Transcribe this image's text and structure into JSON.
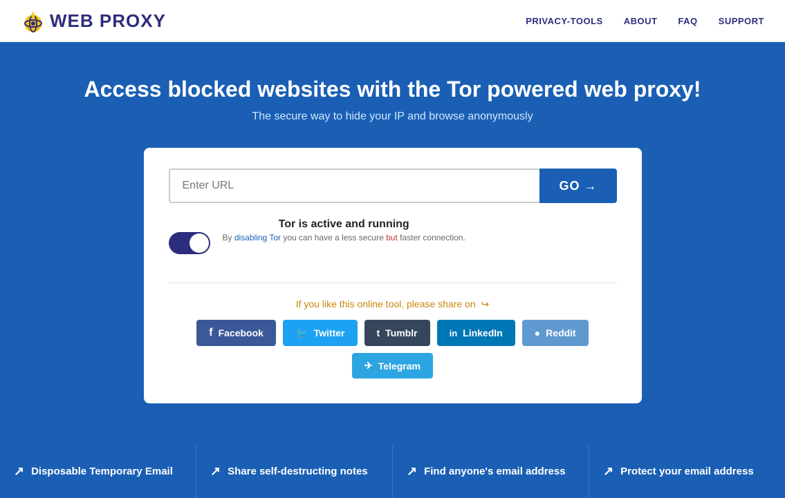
{
  "header": {
    "logo_text_web": "WEB",
    "logo_text_proxy": "PROXY",
    "nav": [
      {
        "label": "PRIVACY-TOOLS",
        "id": "privacy-tools"
      },
      {
        "label": "ABOUT",
        "id": "about"
      },
      {
        "label": "FAQ",
        "id": "faq"
      },
      {
        "label": "SUPPORT",
        "id": "support"
      }
    ]
  },
  "hero": {
    "headline": "Access blocked websites with the Tor powered web proxy!",
    "subheadline": "The secure way to hide your IP and browse anonymously"
  },
  "card": {
    "url_placeholder": "Enter URL",
    "go_label": "GO →",
    "tor_title": "Tor is active and running",
    "tor_description_pre": "By ",
    "tor_link": "disabling Tor",
    "tor_description_mid": " you can have a less secure ",
    "tor_description_highlight": "but",
    "tor_description_post": " faster connection.",
    "share_text": "If you like this online tool, please share on",
    "social_buttons": [
      {
        "label": "Facebook",
        "class": "btn-facebook",
        "icon": "f"
      },
      {
        "label": "Twitter",
        "class": "btn-twitter",
        "icon": "t"
      },
      {
        "label": "Tumblr",
        "class": "btn-tumblr",
        "icon": "t"
      },
      {
        "label": "LinkedIn",
        "class": "btn-linkedin",
        "icon": "in"
      },
      {
        "label": "Reddit",
        "class": "btn-reddit",
        "icon": "r"
      },
      {
        "label": "Telegram",
        "class": "btn-telegram",
        "icon": "➤"
      }
    ]
  },
  "footer": {
    "items": [
      {
        "label": "Disposable Temporary Email"
      },
      {
        "label": "Share self-destructing notes"
      },
      {
        "label": "Find anyone's email address"
      },
      {
        "label": "Protect your email address"
      }
    ]
  }
}
